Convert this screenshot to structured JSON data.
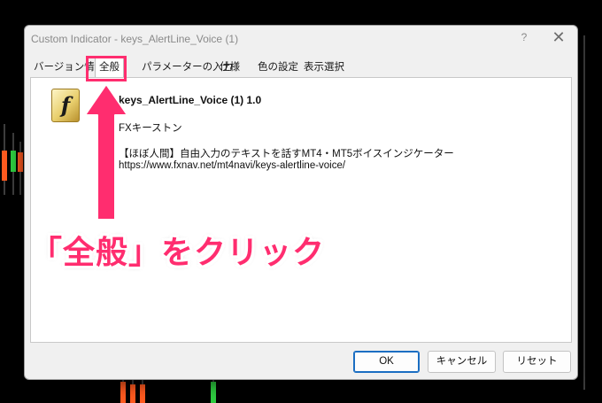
{
  "window": {
    "title": "Custom Indicator - keys_AlertLine_Voice (1)",
    "help_label": "?",
    "close_label": "✕"
  },
  "tabs": [
    {
      "label": "バージョン情報"
    },
    {
      "label": "全般"
    },
    {
      "label": "パラメーターの入力"
    },
    {
      "label": "仕様"
    },
    {
      "label": "色の設定"
    },
    {
      "label": "表示選択"
    }
  ],
  "indicator": {
    "icon_glyph": "f",
    "icon_name": "function-icon",
    "name": "keys_AlertLine_Voice (1) 1.0",
    "author": "FXキーストン",
    "description": "【ほぼ人間】自由入力のテキストを話すMT4・MT5ボイスインジケーター",
    "url": "https://www.fxnav.net/mt4navi/keys-alertline-voice/"
  },
  "buttons": {
    "ok": "OK",
    "cancel": "キャンセル",
    "reset": "リセット"
  },
  "annotation": {
    "text": "「全般」をクリック"
  },
  "colors": {
    "accent": "#ff2d6f",
    "bull": "#2ecc40",
    "bear": "#ff5a1f"
  }
}
